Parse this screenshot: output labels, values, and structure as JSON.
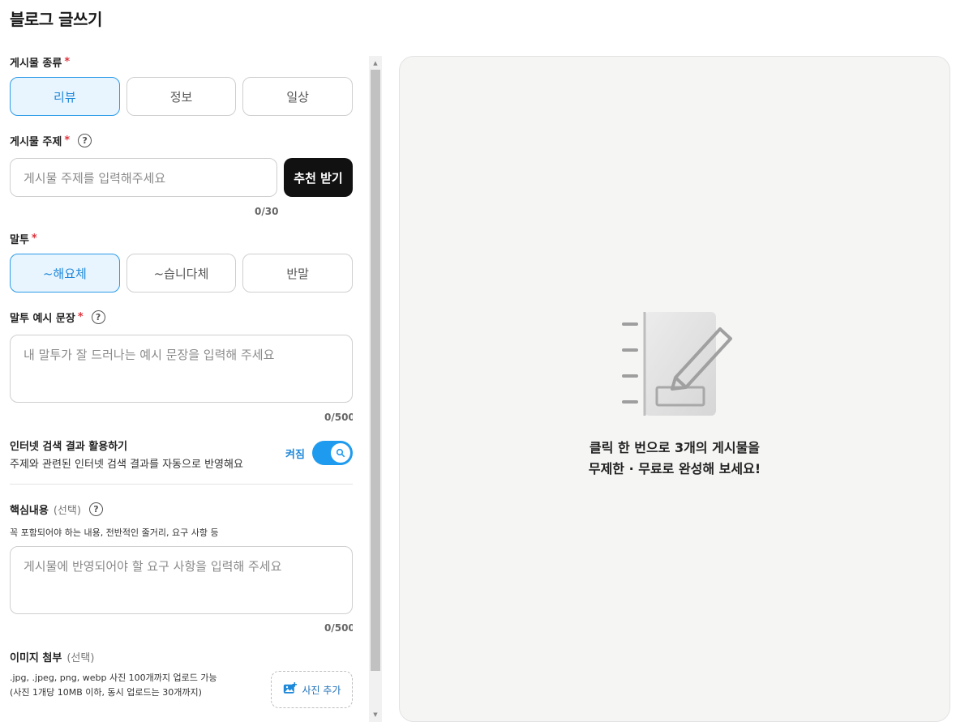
{
  "page": {
    "title": "블로그 글쓰기"
  },
  "post_type": {
    "label": "게시물 종류",
    "required_mark": "*",
    "options": [
      "리뷰",
      "정보",
      "일상"
    ],
    "selected": "리뷰"
  },
  "topic": {
    "label": "게시물 주제",
    "required_mark": "*",
    "placeholder": "게시물 주제를 입력해주세요",
    "counter": "0/30",
    "recommend_label": "추천 받기"
  },
  "tone": {
    "label": "말투",
    "required_mark": "*",
    "options": [
      "~해요체",
      "~습니다체",
      "반말"
    ],
    "selected": "~해요체"
  },
  "tone_example": {
    "label": "말투 예시 문장",
    "required_mark": "*",
    "placeholder": "내 말투가 잘 드러나는 예시 문장을 입력해 주세요",
    "counter": "0/500"
  },
  "web_search": {
    "title": "인터넷 검색 결과 활용하기",
    "description": "주제와 관련된 인터넷 검색 결과를 자동으로 반영해요",
    "state_label": "켜짐",
    "enabled": true
  },
  "key_content": {
    "label": "핵심내용",
    "optional": "(선택)",
    "hint": "꼭 포함되어야 하는 내용, 전반적인 줄거리, 요구 사항 등",
    "placeholder": "게시물에 반영되어야 할 요구 사항을 입력해 주세요",
    "counter": "0/500"
  },
  "image_attach": {
    "label": "이미지 첨부",
    "optional": "(선택)",
    "info_line1": ".jpg, .jpeg, png, webp 사진 100개까지 업로드 가능",
    "info_line2": "(사진 1개당 10MB 이하, 동시 업로드는 30개까지)",
    "button_label": "사진 추가"
  },
  "preview": {
    "line1": "클릭 한 번으로 3개의 게시물을",
    "line2": "무제한 · 무료로 완성해 보세요!",
    "icon": "notebook-pencil-icon"
  },
  "colors": {
    "accent": "#1e9bef",
    "selected_bg": "#e9f5fe",
    "required": "#e0323c",
    "button_dark": "#111111",
    "preview_bg": "#f5f5f4"
  }
}
